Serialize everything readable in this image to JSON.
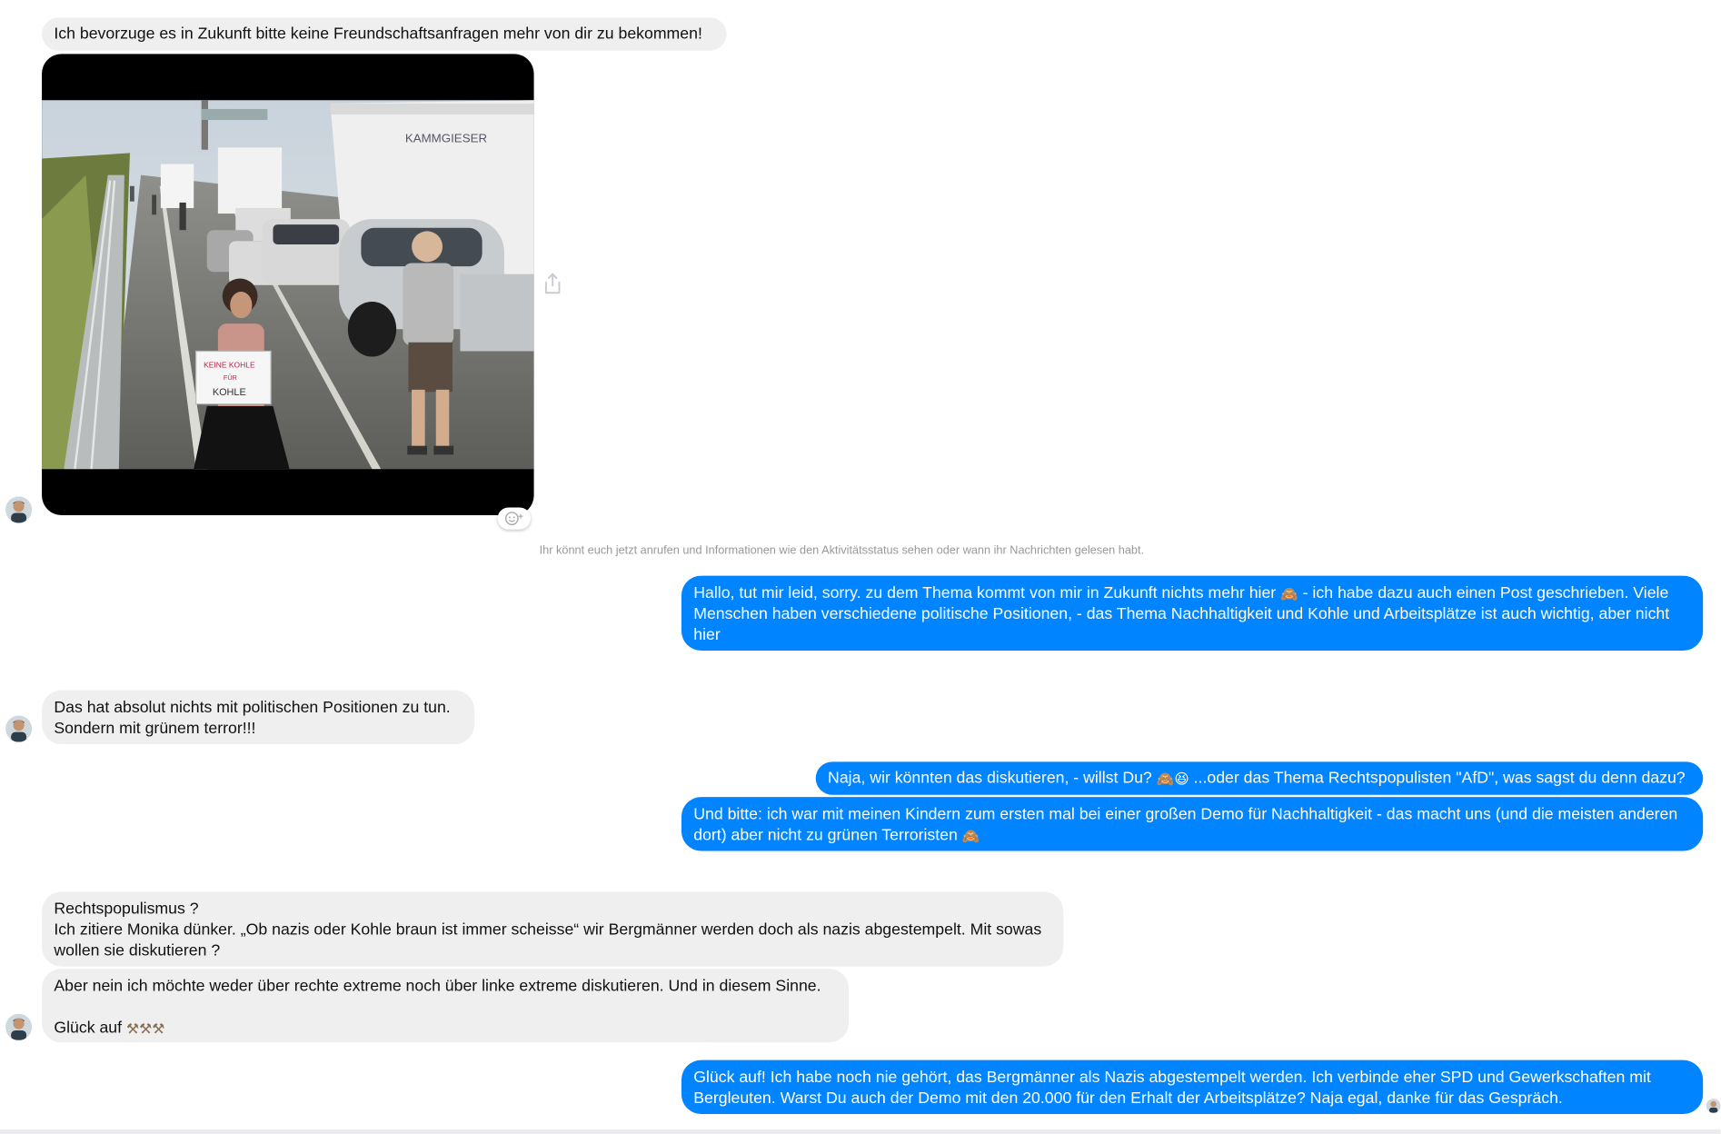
{
  "colors": {
    "incoming_bubble": "#efefef",
    "outgoing_bubble": "#0084ff",
    "status_text": "#999999"
  },
  "messages": {
    "m1": "Ich bevorzuge es in Zukunft bitte keine Freundschaftsanfragen mehr von dir zu bekommen!",
    "status_line": "Ihr könnt euch jetzt anrufen und Informationen wie den Aktivitätsstatus sehen oder wann ihr Nachrichten gelesen habt.",
    "m2_a": "Hallo, tut mir leid, sorry. zu dem Thema kommt von mir in Zukunft nichts mehr hier ",
    "m2_b": " - ich habe dazu auch einen Post geschrieben. Viele Menschen haben verschiedene politische Positionen, - das Thema Nachhaltigkeit und Kohle und Arbeitsplätze ist auch wichtig, aber nicht hier",
    "m3": "Das hat absolut nichts mit politischen Positionen zu tun.\nSondern mit grünem terror!!!",
    "m4_a": "Naja, wir könnten das diskutieren, - willst Du? ",
    "m4_b": " ...oder das Thema Rechtspopulisten \"AfD\", was sagst du denn dazu?",
    "m5_a": "Und bitte: ich war mit meinen Kindern zum ersten mal bei einer großen Demo für Nachhaltigkeit - das macht uns (und die meisten anderen dort) aber nicht zu grünen Terroristen ",
    "m6": "Rechtspopulismus ?\nIch zitiere Monika dünker. „Ob nazis oder Kohle braun ist immer scheisse“ wir Bergmänner werden doch als nazis abgestempelt. Mit sowas wollen sie diskutieren ?",
    "m7_a": "Aber nein ich möchte weder über rechte extreme noch über linke extreme diskutieren. Und in diesem Sinne.\n\nGlück auf ",
    "m7_pick": "⚒⚒⚒",
    "m8": "Glück auf! Ich habe noch nie gehört, das Bergmänner als Nazis abgestempelt werden. Ich verbinde eher SPD und Gewerkschaften mit Bergleuten. Warst Du auch der Demo mit den 20.000 für den Erhalt der Arbeitsplätze? Naja egal, danke für das Gespräch."
  },
  "icons": {
    "emoji_hiding": "monkey-emoji",
    "emoji_grin": "grin-emoji",
    "pick": "hammer-pick-emoji",
    "share": "share-icon",
    "reaction": "add-reaction-icon"
  },
  "photo": {
    "sign_line1": "KEINE KOHLE",
    "sign_line2": "FÜR",
    "sign_line3": "KOHLE"
  }
}
